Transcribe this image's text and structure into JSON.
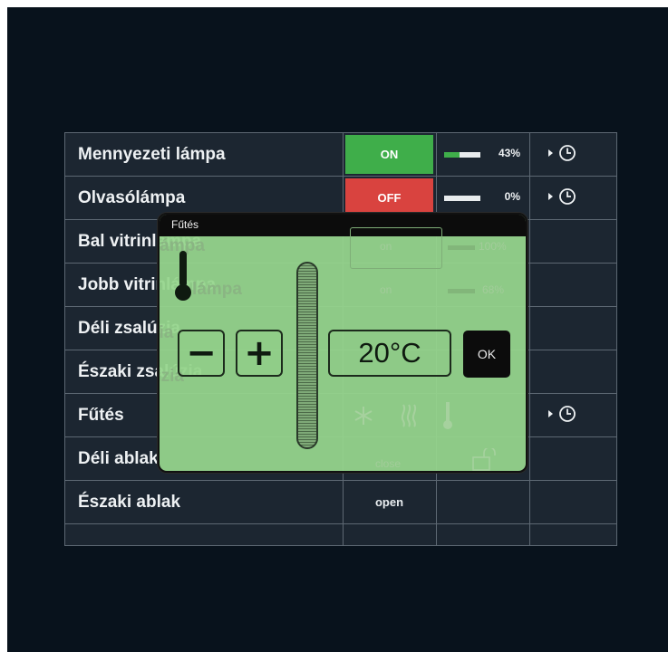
{
  "rows": [
    {
      "name": "Mennyezeti lámpa",
      "state": "ON",
      "level_label": "43%",
      "level": 0.43,
      "timer": true
    },
    {
      "name": "Olvasólámpa",
      "state": "OFF",
      "level_label": "0%",
      "level": 0.0,
      "timer": true
    },
    {
      "name": "Bal vitrinlámpa"
    },
    {
      "name": "Jobb vitrinlámpa"
    },
    {
      "name": "Déli zsalúzia"
    },
    {
      "name": "Északi zsalúzia"
    },
    {
      "name": "Fűtés",
      "timer": true
    },
    {
      "name": "Déli ablak"
    },
    {
      "name": "Északi ablak",
      "state": "open"
    }
  ],
  "dialog": {
    "title": "Fűtés",
    "minus_label": "−",
    "plus_label": "+",
    "temperature": "20°C",
    "ok_label": "OK",
    "background_hints": {
      "bal_vitrin_state": "on",
      "bal_vitrin_level": "100%",
      "jobb_vitrin_state": "on",
      "jobb_vitrin_level": "68%",
      "deli_ablak_state": "close"
    }
  },
  "colors": {
    "on": "#3fae4a",
    "off": "#d9433f",
    "dialog_bg": "#96d48c",
    "screen_bg": "#08121c"
  },
  "icons": {
    "timer": "clock-icon",
    "expand": "triangle-right-icon",
    "dialog": "thermometer-icon"
  }
}
